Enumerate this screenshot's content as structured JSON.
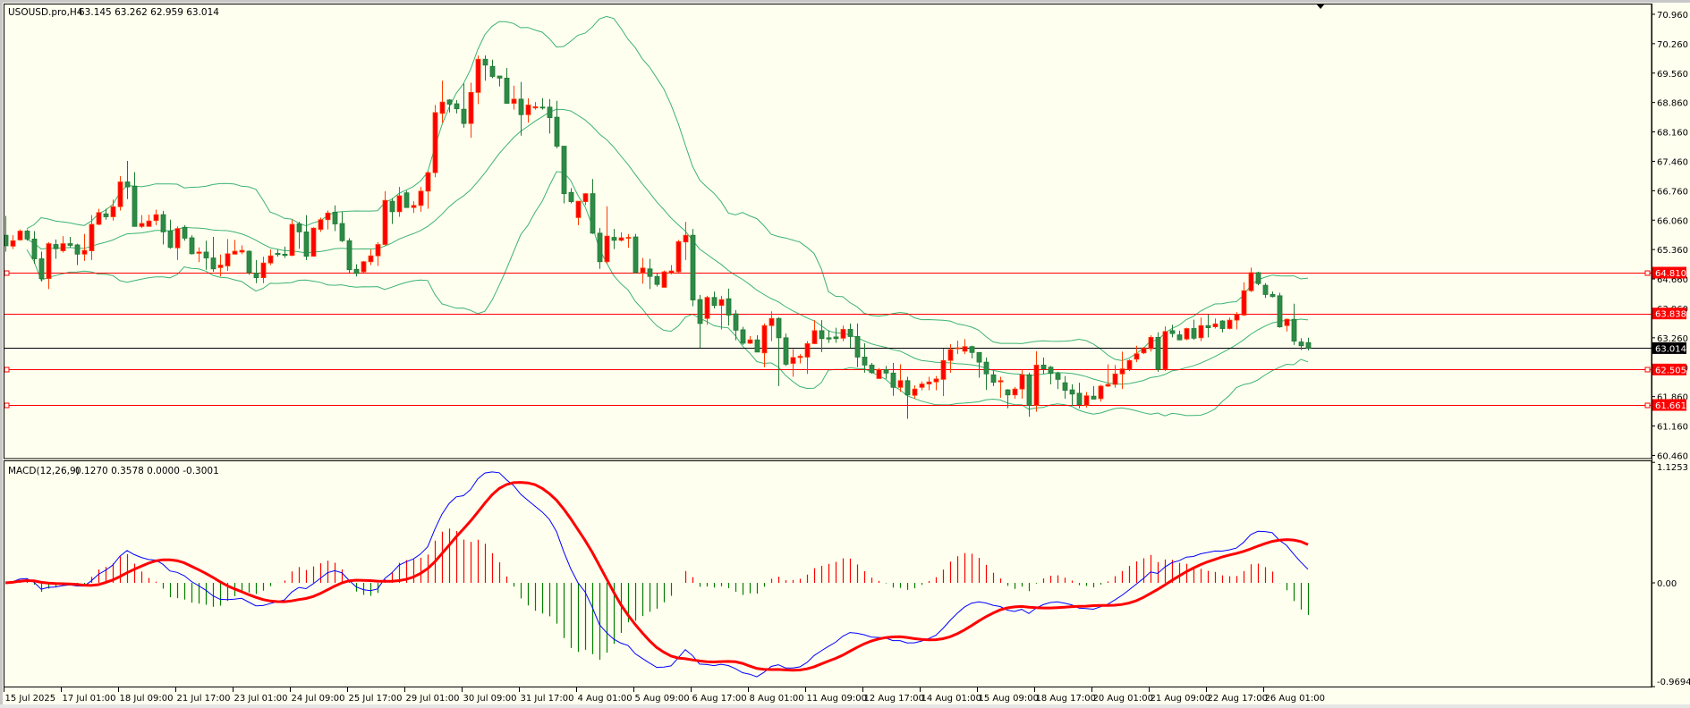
{
  "header": {
    "symbol": "USOUSD.pro,H4",
    "ohlc": "63.145 63.262 62.959 63.014"
  },
  "macd_header": {
    "name": "MACD(12,26,9)",
    "values": "0.1270 0.3578 0.0000 -0.3001"
  },
  "colors": {
    "background": "#fffff0",
    "bull_candle": "#ff0000",
    "bull_outline": "#ff3c00",
    "bear_candle": "#2e8b47",
    "bear_outline": "#1f7a35",
    "bollinger": "#3cb371",
    "macd_main": "#0000ff",
    "macd_signal": "#ff0000",
    "hist_positive": "#ff0000",
    "hist_negative": "#008000",
    "level_line": "#ff0000",
    "bid_line": "#000000"
  },
  "chart_data": {
    "type": "candlestick",
    "title": "USOUSD.pro,H4",
    "ylim": [
      60.46,
      70.96
    ],
    "price_ticks": [
      "70.960",
      "70.260",
      "69.560",
      "68.860",
      "68.160",
      "67.460",
      "66.760",
      "66.060",
      "65.360",
      "64.660",
      "63.960",
      "63.260",
      "62.560",
      "61.860",
      "61.160",
      "60.460"
    ],
    "levels": [
      {
        "label": "64.810",
        "value": 64.81,
        "type": "resistance"
      },
      {
        "label": "63.838",
        "value": 63.838,
        "type": "level"
      },
      {
        "label": "62.505",
        "value": 62.505,
        "type": "support"
      },
      {
        "label": "61.661",
        "value": 61.661,
        "type": "support"
      }
    ],
    "bid": {
      "label": "63.014",
      "value": 63.014
    },
    "time_labels": [
      "15 Jul 2025",
      "17 Jul 01:00",
      "18 Jul 09:00",
      "21 Jul 17:00",
      "23 Jul 01:00",
      "24 Jul 09:00",
      "25 Jul 17:00",
      "29 Jul 01:00",
      "30 Jul 09:00",
      "31 Jul 17:00",
      "4 Aug 01:00",
      "5 Aug 09:00",
      "6 Aug 17:00",
      "8 Aug 01:00",
      "11 Aug 09:00",
      "12 Aug 17:00",
      "14 Aug 01:00",
      "15 Aug 09:00",
      "18 Aug 17:00",
      "20 Aug 01:00",
      "21 Aug 09:00",
      "22 Aug 17:00",
      "26 Aug 01:00"
    ],
    "bars_per_time_label": 8,
    "bollinger": {
      "period": 20,
      "deviations": 2
    },
    "macd": {
      "fast": 12,
      "slow": 26,
      "signal": 9,
      "ylim": [
        -0.9694,
        1.1253
      ],
      "ticks": [
        "1.1253",
        "0.00",
        "-0.9694"
      ],
      "last": {
        "main": 0.127,
        "signal": 0.3578,
        "hist": -0.3001
      }
    },
    "candles_ohlc": [
      [
        65.7,
        66.16,
        65.31,
        65.45
      ],
      [
        65.44,
        65.7,
        65.37,
        65.57
      ],
      [
        65.59,
        65.84,
        65.57,
        65.8
      ],
      [
        65.8,
        65.84,
        65.57,
        65.61
      ],
      [
        65.61,
        65.8,
        65.02,
        65.14
      ],
      [
        65.14,
        65.31,
        64.6,
        64.67
      ],
      [
        64.67,
        65.54,
        64.42,
        65.5
      ],
      [
        65.48,
        65.6,
        65.14,
        65.38
      ],
      [
        65.33,
        65.68,
        65.29,
        65.5
      ],
      [
        65.5,
        65.66,
        65.4,
        65.46
      ],
      [
        65.47,
        65.5,
        64.99,
        65.25
      ],
      [
        65.25,
        65.73,
        65.09,
        65.34
      ],
      [
        65.33,
        66.18,
        65.11,
        65.96
      ],
      [
        65.96,
        66.33,
        65.94,
        66.24
      ],
      [
        66.21,
        66.33,
        66.07,
        66.14
      ],
      [
        66.14,
        66.55,
        66.05,
        66.38
      ],
      [
        66.38,
        67.11,
        66.29,
        66.97
      ],
      [
        66.97,
        67.47,
        66.56,
        66.85
      ],
      [
        66.87,
        67.2,
        65.91,
        65.91
      ],
      [
        65.91,
        66.18,
        65.87,
        65.98
      ],
      [
        65.91,
        66.19,
        65.91,
        66.04
      ],
      [
        66.05,
        66.31,
        65.94,
        66.19
      ],
      [
        66.19,
        66.28,
        65.48,
        65.78
      ],
      [
        65.8,
        66.07,
        65.38,
        65.41
      ],
      [
        65.4,
        65.91,
        65.11,
        65.86
      ],
      [
        65.89,
        65.94,
        65.57,
        65.63
      ],
      [
        65.64,
        65.7,
        65.24,
        65.26
      ],
      [
        65.27,
        65.41,
        65.06,
        65.3
      ],
      [
        65.3,
        65.57,
        64.88,
        65.16
      ],
      [
        65.16,
        65.66,
        64.83,
        64.9
      ],
      [
        64.93,
        65.24,
        64.72,
        64.99
      ],
      [
        64.97,
        65.61,
        64.85,
        65.26
      ],
      [
        65.25,
        65.59,
        65.24,
        65.32
      ],
      [
        65.3,
        65.46,
        65.25,
        65.34
      ],
      [
        65.32,
        65.34,
        64.76,
        64.81
      ],
      [
        64.8,
        65.11,
        64.56,
        64.69
      ],
      [
        64.69,
        65.19,
        64.56,
        65.04
      ],
      [
        65.04,
        65.36,
        64.99,
        65.21
      ],
      [
        65.27,
        65.36,
        65.19,
        65.24
      ],
      [
        65.25,
        65.43,
        65.16,
        65.22
      ],
      [
        65.22,
        66.07,
        65.2,
        65.96
      ],
      [
        65.97,
        66.02,
        65.38,
        65.78
      ],
      [
        65.78,
        66.18,
        65.11,
        65.2
      ],
      [
        65.2,
        65.89,
        65.19,
        65.87
      ],
      [
        65.84,
        66.12,
        65.78,
        66.07
      ],
      [
        66.07,
        66.29,
        65.84,
        66.23
      ],
      [
        66.25,
        66.41,
        65.8,
        65.97
      ],
      [
        65.98,
        66.26,
        65.54,
        65.57
      ],
      [
        65.57,
        65.63,
        64.81,
        64.88
      ],
      [
        64.89,
        65.01,
        64.72,
        64.79
      ],
      [
        64.83,
        65.09,
        64.81,
        65.07
      ],
      [
        65.07,
        65.36,
        64.99,
        65.21
      ],
      [
        65.21,
        65.54,
        64.97,
        65.48
      ],
      [
        65.48,
        66.75,
        65.45,
        66.53
      ],
      [
        66.51,
        66.58,
        65.97,
        66.26
      ],
      [
        66.26,
        66.85,
        66.14,
        66.64
      ],
      [
        66.71,
        66.76,
        66.36,
        66.36
      ],
      [
        66.36,
        66.51,
        66.23,
        66.41
      ],
      [
        66.41,
        66.85,
        66.26,
        66.75
      ],
      [
        66.75,
        67.22,
        66.33,
        67.19
      ],
      [
        67.19,
        68.8,
        67.08,
        68.62
      ],
      [
        68.6,
        69.38,
        68.38,
        68.87
      ],
      [
        68.92,
        68.94,
        68.62,
        68.82
      ],
      [
        68.83,
        68.92,
        68.6,
        68.71
      ],
      [
        68.7,
        69.31,
        68.26,
        68.36
      ],
      [
        68.36,
        69.33,
        68.02,
        69.1
      ],
      [
        69.1,
        69.98,
        68.82,
        69.89
      ],
      [
        69.89,
        69.98,
        69.38,
        69.75
      ],
      [
        69.72,
        69.88,
        69.44,
        69.48
      ],
      [
        69.49,
        69.49,
        69.24,
        69.44
      ],
      [
        69.44,
        69.68,
        68.84,
        68.84
      ],
      [
        68.84,
        69.26,
        68.69,
        68.94
      ],
      [
        68.94,
        69.35,
        68.07,
        68.57
      ],
      [
        68.57,
        68.96,
        68.38,
        68.8
      ],
      [
        68.73,
        68.87,
        68.69,
        68.76
      ],
      [
        68.75,
        68.96,
        68.69,
        68.73
      ],
      [
        68.75,
        68.94,
        68.12,
        68.5
      ],
      [
        68.51,
        68.9,
        67.77,
        67.82
      ],
      [
        67.82,
        67.82,
        66.46,
        66.69
      ],
      [
        66.72,
        66.82,
        66.46,
        66.5
      ],
      [
        66.12,
        66.51,
        65.94,
        66.51
      ],
      [
        66.5,
        66.7,
        66.42,
        66.69
      ],
      [
        66.69,
        67.04,
        65.73,
        65.75
      ],
      [
        65.75,
        65.87,
        64.9,
        65.07
      ],
      [
        65.07,
        66.39,
        65.02,
        65.68
      ],
      [
        65.65,
        65.85,
        65.37,
        65.58
      ],
      [
        65.58,
        65.77,
        65.55,
        65.64
      ],
      [
        65.63,
        65.73,
        65.4,
        65.65
      ],
      [
        65.66,
        65.73,
        64.81,
        64.81
      ],
      [
        64.81,
        65.16,
        64.55,
        64.92
      ],
      [
        64.9,
        65.14,
        64.42,
        64.72
      ],
      [
        64.72,
        64.79,
        64.48,
        64.53
      ],
      [
        64.46,
        64.86,
        64.46,
        64.83
      ],
      [
        64.8,
        64.99,
        64.77,
        64.85
      ],
      [
        64.83,
        65.59,
        64.81,
        65.55
      ],
      [
        65.54,
        66.02,
        65.11,
        65.7
      ],
      [
        65.7,
        65.85,
        64.01,
        64.16
      ],
      [
        64.17,
        64.28,
        63.02,
        63.6
      ],
      [
        63.72,
        64.26,
        63.57,
        64.22
      ],
      [
        64.22,
        64.36,
        63.96,
        64.03
      ],
      [
        64.03,
        64.26,
        63.46,
        64.17
      ],
      [
        64.19,
        64.43,
        63.55,
        63.8
      ],
      [
        63.83,
        63.92,
        63.2,
        63.44
      ],
      [
        63.45,
        63.52,
        63.09,
        63.13
      ],
      [
        63.13,
        63.3,
        63.11,
        63.21
      ],
      [
        63.21,
        63.32,
        62.92,
        62.92
      ],
      [
        62.9,
        63.6,
        62.56,
        63.55
      ],
      [
        63.55,
        63.89,
        63.18,
        63.72
      ],
      [
        63.72,
        63.75,
        62.11,
        63.26
      ],
      [
        63.26,
        63.36,
        62.59,
        62.63
      ],
      [
        62.65,
        62.99,
        62.33,
        62.79
      ],
      [
        62.79,
        62.87,
        62.65,
        62.82
      ],
      [
        62.8,
        63.18,
        62.4,
        63.12
      ],
      [
        63.12,
        63.68,
        63.11,
        63.43
      ],
      [
        63.43,
        63.68,
        62.92,
        63.24
      ],
      [
        63.26,
        63.44,
        63.14,
        63.23
      ],
      [
        63.28,
        63.5,
        63.14,
        63.24
      ],
      [
        63.25,
        63.55,
        63.18,
        63.46
      ],
      [
        63.46,
        63.6,
        63.02,
        63.29
      ],
      [
        63.29,
        63.6,
        62.56,
        62.8
      ],
      [
        62.8,
        63.13,
        62.43,
        62.61
      ],
      [
        62.61,
        62.66,
        62.4,
        62.43
      ],
      [
        62.29,
        62.54,
        62.28,
        62.5
      ],
      [
        62.5,
        62.59,
        62.28,
        62.42
      ],
      [
        62.42,
        62.66,
        61.88,
        62.08
      ],
      [
        62.08,
        62.63,
        61.97,
        62.24
      ],
      [
        62.24,
        62.33,
        61.33,
        61.9
      ],
      [
        61.89,
        62.13,
        61.81,
        62.04
      ],
      [
        62.08,
        62.22,
        62.01,
        62.16
      ],
      [
        62.16,
        62.33,
        62.01,
        62.21
      ],
      [
        62.21,
        62.35,
        62.01,
        62.28
      ],
      [
        62.27,
        63.0,
        61.87,
        62.72
      ],
      [
        62.72,
        63.11,
        62.43,
        62.98
      ],
      [
        63.0,
        63.19,
        62.87,
        63.02
      ],
      [
        62.94,
        63.23,
        62.87,
        63.05
      ],
      [
        63.05,
        63.07,
        62.77,
        62.91
      ],
      [
        62.91,
        62.92,
        62.31,
        62.68
      ],
      [
        62.68,
        62.79,
        62.02,
        62.4
      ],
      [
        62.38,
        62.47,
        62.11,
        62.2
      ],
      [
        62.21,
        62.33,
        61.83,
        62.24
      ],
      [
        62.02,
        62.04,
        61.58,
        61.9
      ],
      [
        61.9,
        62.09,
        61.81,
        62.04
      ],
      [
        62.04,
        62.5,
        61.81,
        62.38
      ],
      [
        62.38,
        62.43,
        61.38,
        61.65
      ],
      [
        61.65,
        62.94,
        61.5,
        62.61
      ],
      [
        62.61,
        62.79,
        62.4,
        62.52
      ],
      [
        62.56,
        62.59,
        62.15,
        62.41
      ],
      [
        62.41,
        62.45,
        62.04,
        62.27
      ],
      [
        62.19,
        62.35,
        61.81,
        62.01
      ],
      [
        62.02,
        62.15,
        61.64,
        61.92
      ],
      [
        61.94,
        62.19,
        61.58,
        61.67
      ],
      [
        61.65,
        61.97,
        61.6,
        61.88
      ],
      [
        61.87,
        62.11,
        61.8,
        61.8
      ],
      [
        61.81,
        62.14,
        61.74,
        62.11
      ],
      [
        62.11,
        62.63,
        62.09,
        62.15
      ],
      [
        62.15,
        62.61,
        62.07,
        62.4
      ],
      [
        62.4,
        62.93,
        62.04,
        62.52
      ],
      [
        62.51,
        62.75,
        62.47,
        62.72
      ],
      [
        62.75,
        63.07,
        62.68,
        62.88
      ],
      [
        62.9,
        63.04,
        62.87,
        63.02
      ],
      [
        63.0,
        63.32,
        62.93,
        63.27
      ],
      [
        63.27,
        63.39,
        62.45,
        62.51
      ],
      [
        62.51,
        63.53,
        62.47,
        63.41
      ],
      [
        63.43,
        63.57,
        63.27,
        63.36
      ],
      [
        63.33,
        63.43,
        63.2,
        63.21
      ],
      [
        63.23,
        63.5,
        63.2,
        63.48
      ],
      [
        63.48,
        63.69,
        63.21,
        63.25
      ],
      [
        63.26,
        63.74,
        63.18,
        63.55
      ],
      [
        63.55,
        63.81,
        63.27,
        63.5
      ],
      [
        63.52,
        63.72,
        63.48,
        63.59
      ],
      [
        63.66,
        63.68,
        63.39,
        63.48
      ],
      [
        63.48,
        63.74,
        63.46,
        63.68
      ],
      [
        63.68,
        63.87,
        63.46,
        63.82
      ],
      [
        63.8,
        64.58,
        63.78,
        64.38
      ],
      [
        64.38,
        64.93,
        64.35,
        64.81
      ],
      [
        64.81,
        64.83,
        64.51,
        64.55
      ],
      [
        64.51,
        64.56,
        64.21,
        64.29
      ],
      [
        64.29,
        64.36,
        64.22,
        64.24
      ],
      [
        64.26,
        64.33,
        63.5,
        63.52
      ],
      [
        63.55,
        63.72,
        63.41,
        63.7
      ],
      [
        63.7,
        64.07,
        63.09,
        63.18
      ],
      [
        63.16,
        63.25,
        62.97,
        63.07
      ],
      [
        63.145,
        63.262,
        62.959,
        63.014
      ]
    ]
  }
}
